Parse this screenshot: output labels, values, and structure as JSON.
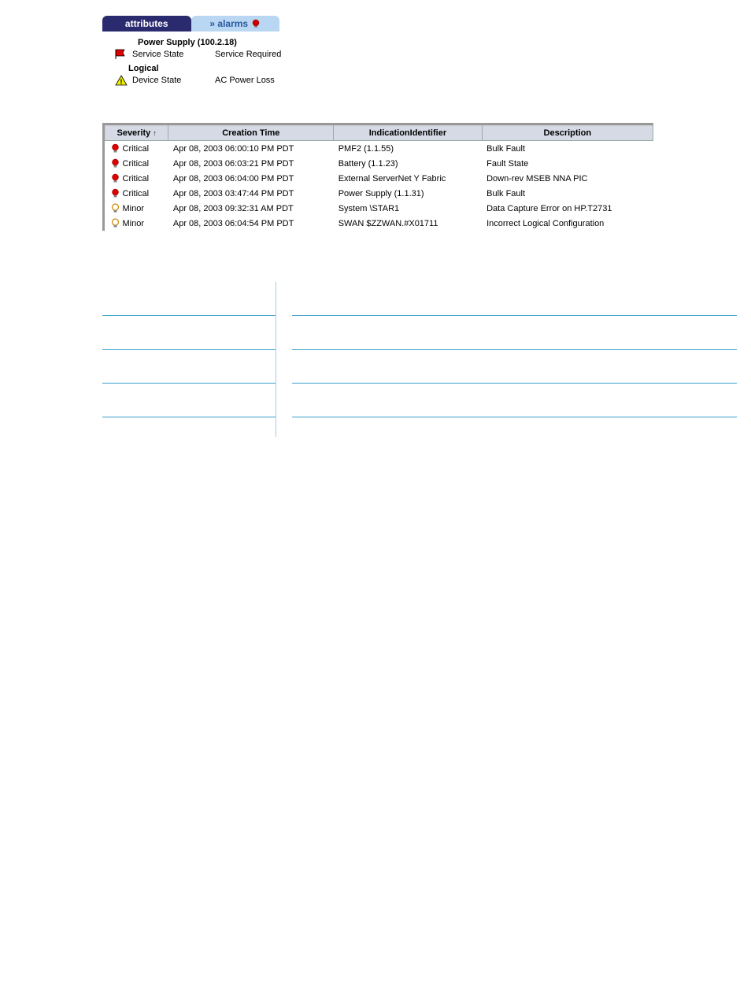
{
  "tabs": {
    "attributes": "attributes",
    "alarms": "» alarms"
  },
  "attr": {
    "title": "Power Supply (100.2.18)",
    "service_state_label": "Service State",
    "service_state_value": "Service Required",
    "logical_label": "Logical",
    "device_state_label": "Device State",
    "device_state_value": "AC Power Loss"
  },
  "alarm_headers": {
    "severity": "Severity",
    "creation": "Creation Time",
    "indicator": "IndicationIdentifier",
    "description": "Description"
  },
  "alarms": [
    {
      "severity": "Critical",
      "time": "Apr 08, 2003 06:00:10 PM PDT",
      "id": "PMF2 (1.1.55)",
      "desc": "Bulk Fault"
    },
    {
      "severity": "Critical",
      "time": "Apr 08, 2003 06:03:21 PM PDT",
      "id": "Battery (1.1.23)",
      "desc": "Fault State"
    },
    {
      "severity": "Critical",
      "time": "Apr 08, 2003 06:04:00 PM PDT",
      "id": "External ServerNet Y Fabric",
      "desc": "Down-rev MSEB NNA PIC"
    },
    {
      "severity": "Critical",
      "time": "Apr 08, 2003 03:47:44 PM PDT",
      "id": "Power Supply (1.1.31)",
      "desc": "Bulk Fault"
    },
    {
      "severity": "Minor",
      "time": "Apr 08, 2003 09:32:31 AM PDT",
      "id": "System \\STAR1",
      "desc": "Data Capture Error on HP.T2731"
    },
    {
      "severity": "Minor",
      "time": "Apr 08, 2003 06:04:54 PM PDT",
      "id": "SWAN $ZZWAN.#X01711",
      "desc": "Incorrect Logical Configuration"
    }
  ],
  "sort_arrow": "↑"
}
